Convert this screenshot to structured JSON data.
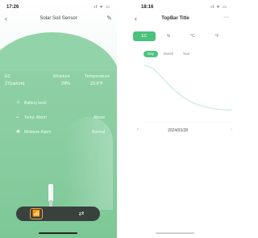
{
  "left": {
    "status_time": "17:26",
    "status_icons": "ıl ᯤ ▭",
    "title": "Solar Soil Sensor",
    "metrics": [
      {
        "label": "EC",
        "value": "27(us/cm)"
      },
      {
        "label": "Moisture",
        "value": "29%"
      },
      {
        "label": "Temperature",
        "value": "23.6°F"
      }
    ],
    "rows": [
      {
        "icon": "☼",
        "label": "Battery level",
        "value": ""
      },
      {
        "icon": "⌁",
        "label": "Temp. Alarm",
        "value": "Above"
      },
      {
        "icon": "✚",
        "label": "Moisture Alarm",
        "value": "Normal"
      }
    ],
    "tab_icons": [
      "📶",
      "⇄"
    ]
  },
  "right": {
    "status_time": "18:16",
    "status_icons": "ıl ᯤ ▭",
    "title": "TopBar Title",
    "units": [
      "EC",
      "%",
      "°C",
      "°F"
    ],
    "ranges": [
      "Day",
      "Month",
      "Year"
    ],
    "date": "2024/03/28",
    "chart_data": {
      "type": "line",
      "x": [
        0,
        1,
        2,
        3,
        4,
        5,
        6,
        7,
        8,
        9
      ],
      "values": [
        95,
        88,
        70,
        52,
        38,
        28,
        22,
        18,
        16,
        15
      ],
      "ylim": [
        0,
        100
      ],
      "line_color": "#cfe9dc"
    }
  }
}
